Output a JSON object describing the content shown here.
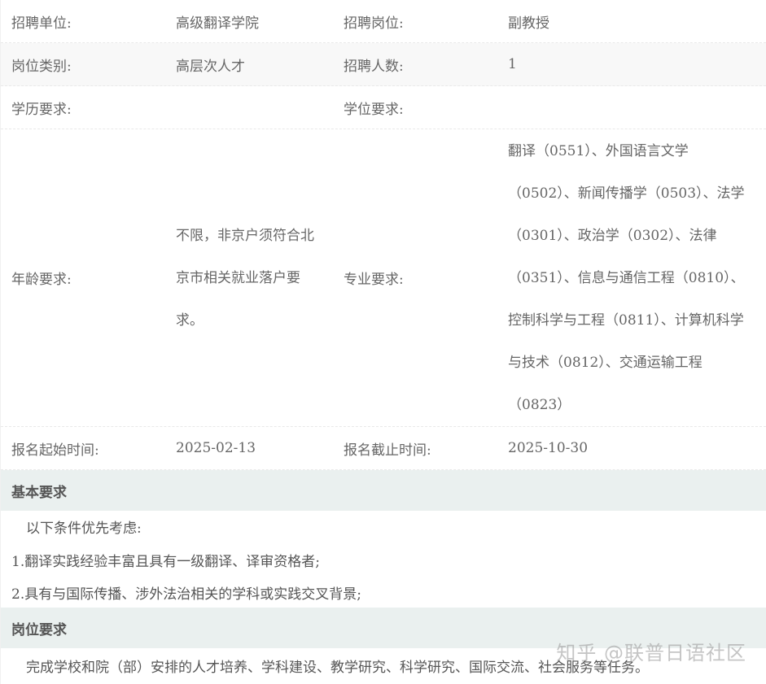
{
  "rows": [
    {
      "label1": "招聘单位:",
      "value1": "高级翻译学院",
      "label2": "招聘岗位:",
      "value2": "副教授"
    },
    {
      "label1": "岗位类别:",
      "value1": "高层次人才",
      "label2": "招聘人数:",
      "value2": "1"
    },
    {
      "label1": "学历要求:",
      "value1": "",
      "label2": "学位要求:",
      "value2": ""
    }
  ],
  "age_row": {
    "label1": "年龄要求:",
    "value1_lines": [
      "不限，非京户须符合北",
      "京市相关就业落户要",
      "求。"
    ],
    "label2": "专业要求:",
    "value2_lines": [
      "翻译（0551）、外国语言文学",
      "（0502）、新闻传播学（0503）、法学",
      "（0301）、政治学（0302）、法律",
      "（0351）、信息与通信工程（0810）、",
      "控制科学与工程（0811）、计算机科学",
      "与技术（0812）、交通运输工程",
      "（0823）"
    ]
  },
  "date_row": {
    "label1": "报名起始时间:",
    "value1": "2025-02-13",
    "label2": "报名截止时间:",
    "value2": "2025-10-30"
  },
  "basic": {
    "heading": "基本要求",
    "lines": [
      "以下条件优先考虑:",
      "1.翻译实践经验丰富且具有一级翻译、译审资格者;",
      "2.具有与国际传播、涉外法治相关的学科或实践交叉背景;"
    ]
  },
  "post": {
    "heading": "岗位要求",
    "line": "完成学校和院（部）安排的人才培养、学科建设、教学研究、科学研究、国际交流、社会服务等任务。"
  },
  "watermark": "知乎 @联普日语社区"
}
